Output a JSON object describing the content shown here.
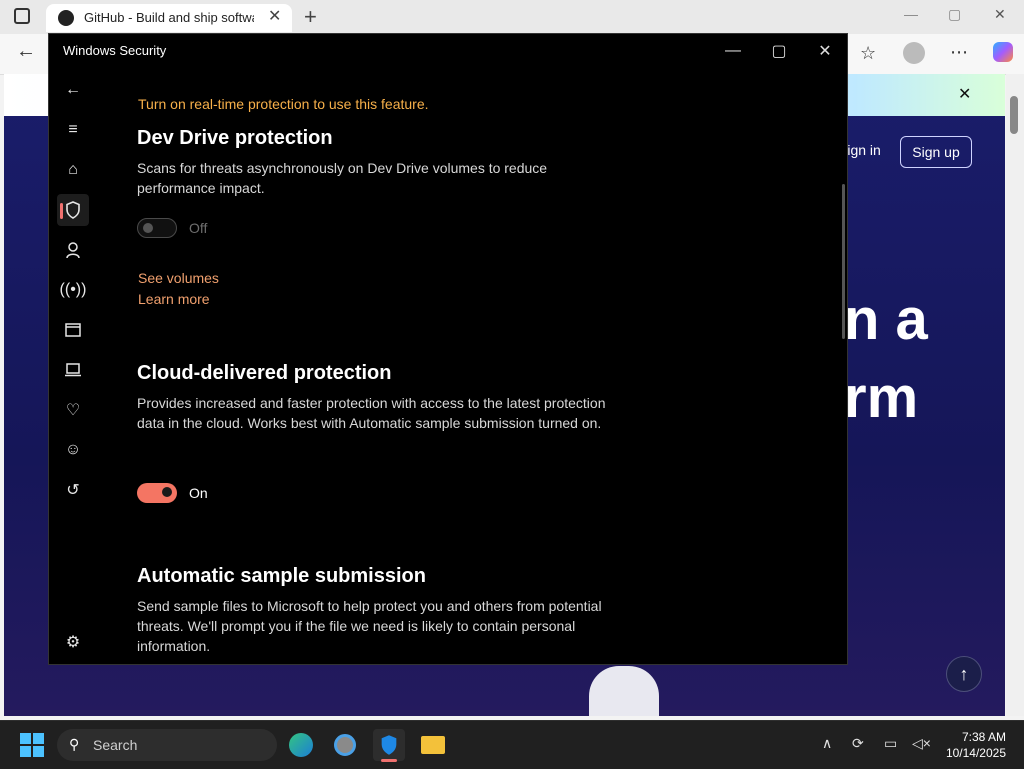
{
  "browser": {
    "tab_title": "GitHub - Build and ship software o",
    "tab_close": "✕",
    "new_tab": "+",
    "back": "←",
    "window_min": "—",
    "window_max": "▢",
    "window_close": "✕"
  },
  "website": {
    "banner_close": "✕",
    "sign_in": "Sign in",
    "sign_up": "Sign up",
    "hero_line1": "n a",
    "hero_line2": "rm",
    "scroll_top": "↑"
  },
  "security": {
    "title": "Windows Security",
    "warning": "Turn on real-time protection to use this feature.",
    "sections": {
      "dev_drive": {
        "title": "Dev Drive protection",
        "description": "Scans for threats asynchronously on Dev Drive volumes to reduce performance impact.",
        "toggle_label": "Off",
        "link1": "See volumes",
        "link2": "Learn more"
      },
      "cloud": {
        "title": "Cloud-delivered protection",
        "description": "Provides increased and faster protection with access to the latest protection data in the cloud. Works best with Automatic sample submission turned on.",
        "toggle_label": "On"
      },
      "sample": {
        "title": "Automatic sample submission",
        "description": "Send sample files to Microsoft to help protect you and others from potential threats. We'll prompt you if the file we need is likely to contain personal information."
      }
    },
    "accent_color": "#f47563",
    "warning_color": "#f7b04a"
  },
  "taskbar": {
    "search_placeholder": "Search",
    "time": "7:38 AM",
    "date": "10/14/2025"
  }
}
